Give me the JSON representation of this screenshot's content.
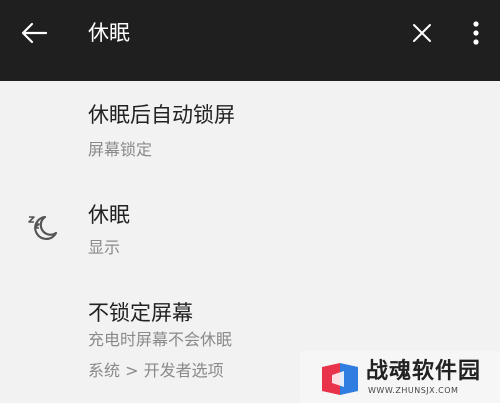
{
  "toolbar": {
    "search_query": "休眠",
    "back_icon": "arrow-left-icon",
    "clear_icon": "close-icon",
    "more_icon": "more-vertical-icon"
  },
  "results": [
    {
      "title": "休眠后自动锁屏",
      "subtitle": "屏幕锁定"
    },
    {
      "title": "休眠",
      "subtitle": "显示",
      "icon": "sleep-moon-icon"
    },
    {
      "title": "不锁定屏幕",
      "subtitle": "充电时屏幕不会休眠",
      "path": "系统 > 开发者选项"
    }
  ],
  "watermark": {
    "name": "战魂软件园",
    "url": "WWW.ZHUNSJX.COM"
  },
  "colors": {
    "toolbar_bg": "#1f1f1f",
    "page_bg": "#f2f2f2",
    "title_text": "#222222",
    "subtitle_text": "#8a8a8a",
    "logo_red": "#e8334a",
    "logo_blue": "#2f7de1"
  }
}
